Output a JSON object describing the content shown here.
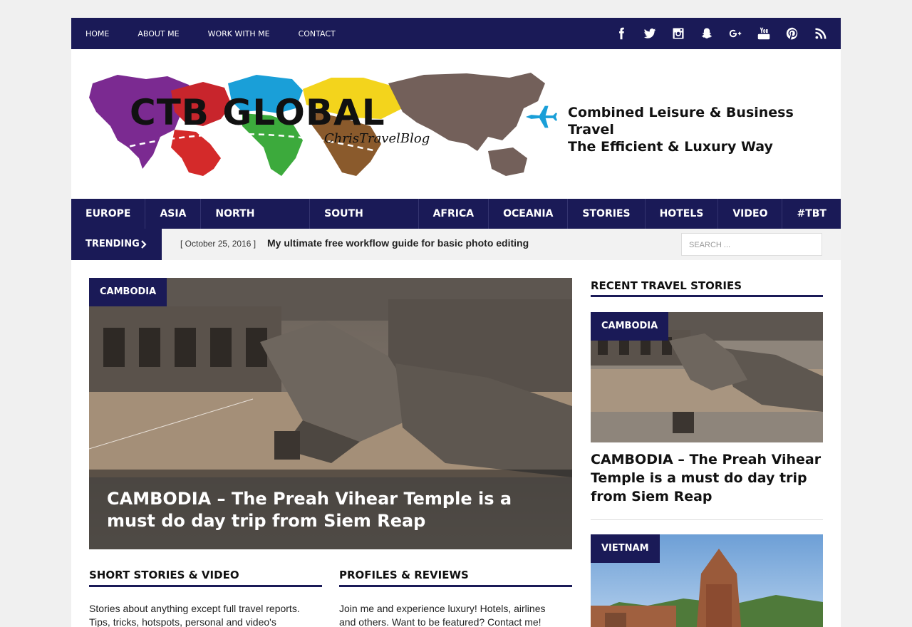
{
  "top_nav": {
    "items": [
      "HOME",
      "ABOUT ME",
      "WORK WITH ME",
      "CONTACT"
    ]
  },
  "social_icons": [
    "facebook-icon",
    "twitter-icon",
    "instagram-icon",
    "snapchat-icon",
    "google-plus-icon",
    "youtube-icon",
    "pinterest-icon",
    "rss-icon"
  ],
  "logo": {
    "title": "CTB GLOBAL",
    "subtitle": "ChrisTravelBlog",
    "tagline_line1": "Combined Leisure & Business Travel",
    "tagline_line2": "The Efficient & Luxury Way"
  },
  "main_nav": {
    "items": [
      "EUROPE",
      "ASIA",
      "NORTH AMERICA",
      "SOUTH AMERICA",
      "AFRICA",
      "OCEANIA",
      "STORIES",
      "HOTELS",
      "VIDEO",
      "#TBT"
    ]
  },
  "trending": {
    "label": "TRENDING",
    "date": "[ October 25, 2016 ]",
    "title": "My ultimate free workflow guide for basic photo editing"
  },
  "search": {
    "placeholder": "SEARCH ..."
  },
  "feature": {
    "category": "CAMBODIA",
    "title": "CAMBODIA – The Preah Vihear Temple is a must do day trip from Siem Reap"
  },
  "sections": {
    "short_stories": {
      "heading": "SHORT STORIES & VIDEO",
      "text": "Stories about anything except full travel reports. Tips, tricks, hotspots, personal and video's"
    },
    "profiles": {
      "heading": "PROFILES & REVIEWS",
      "text": "Join me and experience luxury! Hotels, airlines and others. Want to be featured? Contact me!"
    }
  },
  "sidebar": {
    "heading": "RECENT TRAVEL STORIES",
    "cards": [
      {
        "category": "CAMBODIA",
        "title": "CAMBODIA – The Preah Vihear Temple is a must do day trip from Siem Reap"
      },
      {
        "category": "VIETNAM"
      }
    ]
  },
  "colors": {
    "brand_navy": "#1a1a57"
  }
}
